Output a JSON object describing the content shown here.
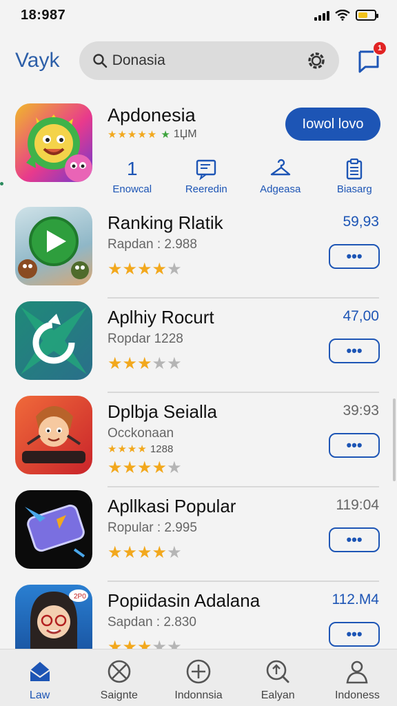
{
  "status_bar": {
    "time": "18:987"
  },
  "header": {
    "brand": "Vayk",
    "search_value": "Donasia",
    "notification_count": "1"
  },
  "featured": {
    "name": "Apdonesia",
    "rating_text": "1ЏМ",
    "install_label": "Iowol lovo",
    "actions": [
      {
        "label": "Enowcal",
        "glyph": "1"
      },
      {
        "label": "Reeredin",
        "glyph": ""
      },
      {
        "label": "Adgeasa",
        "glyph": ""
      },
      {
        "label": "Biasarg",
        "glyph": ""
      }
    ]
  },
  "apps": [
    {
      "name": "Ranking Rlatik",
      "sub": "Rapdan : 2.988",
      "price": "59,93",
      "rating": 4,
      "price_color": "#1d55b5"
    },
    {
      "name": "Aplhiy Rocurt",
      "sub": "Ropdar 1228",
      "price": "47,00",
      "rating": 3.5,
      "price_color": "#1d55b5"
    },
    {
      "name": "Dplbja Seialla",
      "sub": "Occkonaan",
      "sub2": "1288",
      "price": "39:93",
      "rating": 4,
      "price_color": "#666666"
    },
    {
      "name": "Apllkasi Popular",
      "sub": "Ropular : 2.995",
      "price": "119:04",
      "rating": 4,
      "price_color": "#666666"
    },
    {
      "name": "Popiidasin Adalana",
      "sub": "Sapdan : 2.830",
      "price": "112.M4",
      "rating": 3.5,
      "price_color": "#1d55b5"
    }
  ],
  "more_label": "•••",
  "nav": [
    {
      "label": "Law",
      "icon": "home-icon",
      "active": true
    },
    {
      "label": "Saignte",
      "icon": "cross-circle-icon",
      "active": false
    },
    {
      "label": "Indonnsia",
      "icon": "plus-circle-icon",
      "active": false
    },
    {
      "label": "Ealyan",
      "icon": "search-up-icon",
      "active": false
    },
    {
      "label": "Indoness",
      "icon": "profile-icon",
      "active": false
    }
  ],
  "colors": {
    "accent": "#1d55b5",
    "star": "#f2a81d",
    "star_empty": "#b5b5b5"
  }
}
